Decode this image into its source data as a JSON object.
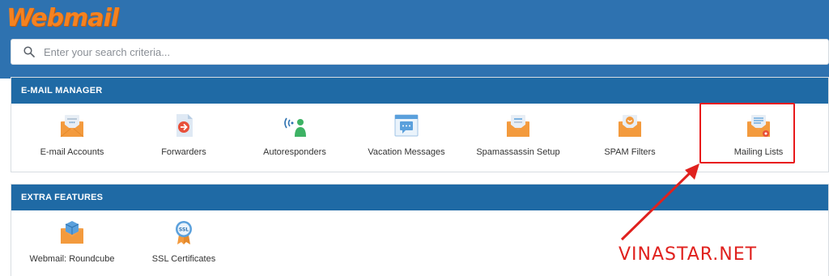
{
  "header": {
    "logo": "Webmail"
  },
  "search": {
    "placeholder": "Enter your search criteria..."
  },
  "email_manager": {
    "title": "E-MAIL MANAGER",
    "items": [
      {
        "label": "E-mail Accounts",
        "icon": "envelope-accounts-icon"
      },
      {
        "label": "Forwarders",
        "icon": "forwarders-icon"
      },
      {
        "label": "Autoresponders",
        "icon": "autoresponders-icon"
      },
      {
        "label": "Vacation Messages",
        "icon": "vacation-messages-icon"
      },
      {
        "label": "Spamassassin Setup",
        "icon": "spamassassin-icon"
      },
      {
        "label": "SPAM Filters",
        "icon": "spam-filters-icon"
      },
      {
        "label": "Mailing Lists",
        "icon": "mailing-lists-icon"
      }
    ]
  },
  "extra_features": {
    "title": "EXTRA FEATURES",
    "items": [
      {
        "label": "Webmail: Roundcube",
        "icon": "roundcube-icon"
      },
      {
        "label": "SSL Certificates",
        "icon": "ssl-certificate-icon"
      }
    ]
  },
  "annotation": {
    "watermark": "VINASTAR.NET",
    "highlight_color": "#e8191b"
  },
  "colors": {
    "brand_blue": "#2e72b0",
    "header_blue": "#1f6aa5",
    "logo_orange": "#f58220"
  }
}
